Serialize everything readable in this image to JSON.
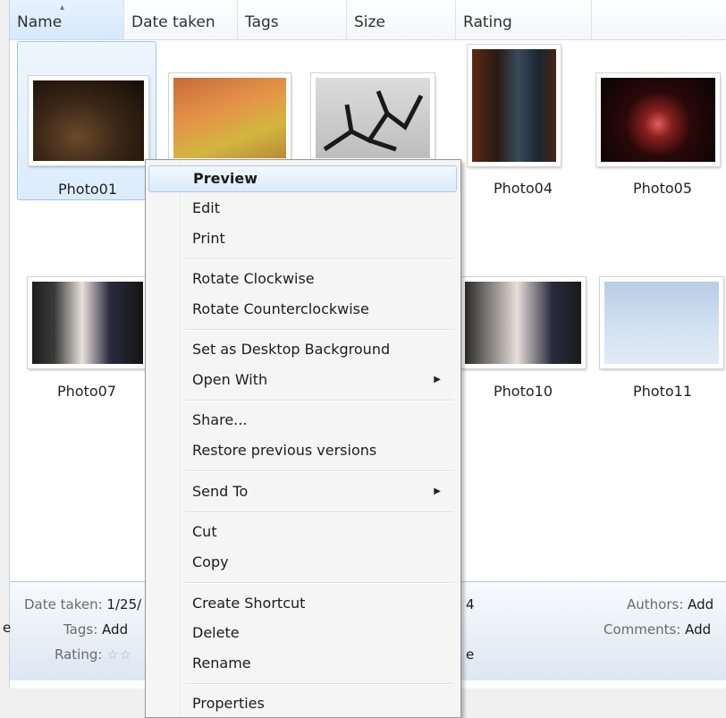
{
  "columns": [
    {
      "id": "name",
      "label": "Name"
    },
    {
      "id": "date_taken",
      "label": "Date taken"
    },
    {
      "id": "tags",
      "label": "Tags"
    },
    {
      "id": "size",
      "label": "Size"
    },
    {
      "id": "rating",
      "label": "Rating"
    }
  ],
  "photos": [
    {
      "name": "Photo01"
    },
    {
      "name": "Photo04"
    },
    {
      "name": "Photo05"
    },
    {
      "name": "Photo07"
    },
    {
      "name": "Photo10"
    },
    {
      "name": "Photo11"
    }
  ],
  "details": {
    "date_taken_label": "Date taken:",
    "date_taken_value": "1/25/",
    "tags_label": "Tags:",
    "tags_value": "Add",
    "rating_label": "Rating:",
    "rating_stars": "☆☆",
    "authors_label": "Authors:",
    "authors_value": "Add",
    "comments_label": "Comments:",
    "comments_value": "Add",
    "left_clip": "e",
    "mid_clip_1": "4",
    "mid_clip_2": "e"
  },
  "context_menu": {
    "items": [
      {
        "label": "Preview"
      },
      {
        "label": "Edit"
      },
      {
        "label": "Print"
      },
      {
        "label": "Rotate Clockwise"
      },
      {
        "label": "Rotate Counterclockwise"
      },
      {
        "label": "Set as Desktop Background"
      },
      {
        "label": "Open With",
        "submenu_arrow": "▶"
      },
      {
        "label": "Share..."
      },
      {
        "label": "Restore previous versions"
      },
      {
        "label": "Send To",
        "submenu_arrow": "▶"
      },
      {
        "label": "Cut"
      },
      {
        "label": "Copy"
      },
      {
        "label": "Create Shortcut"
      },
      {
        "label": "Delete"
      },
      {
        "label": "Rename"
      },
      {
        "label": "Properties"
      }
    ]
  },
  "colors": {
    "selection": "#dcecfc",
    "menu_highlight": "#dbeaf8",
    "details_pane": "#dce7f2"
  }
}
